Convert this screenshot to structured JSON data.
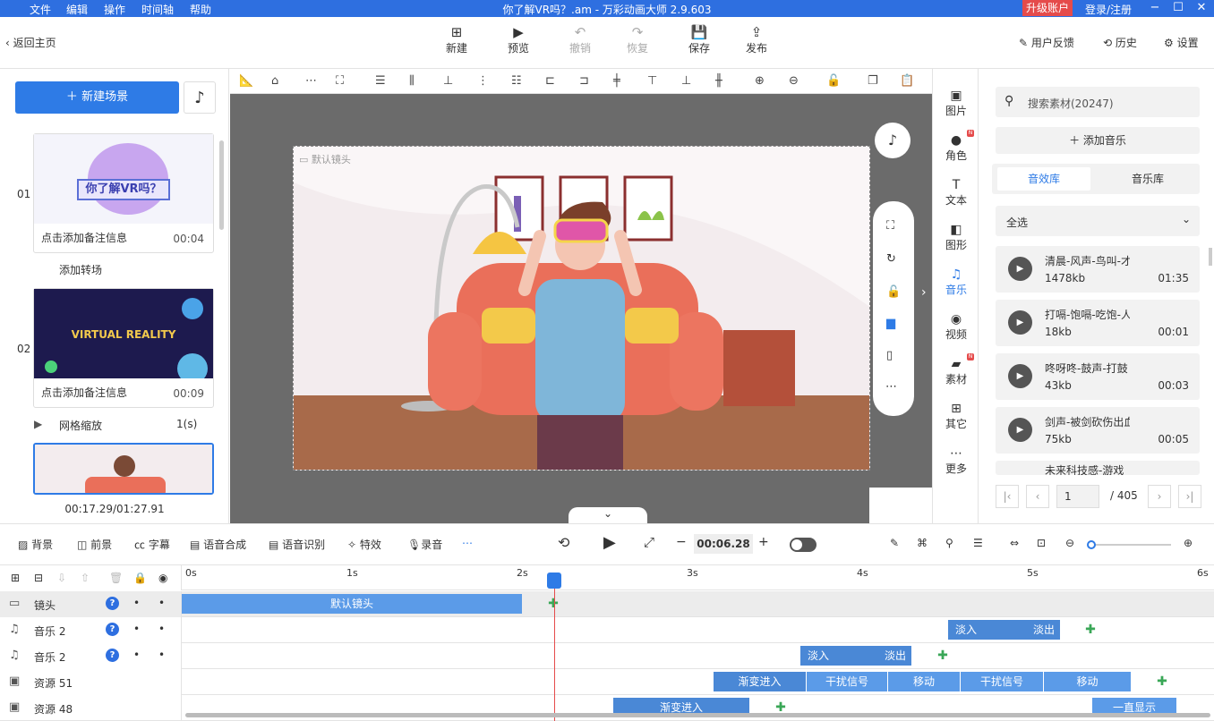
{
  "titlebar": {
    "menus": [
      "文件",
      "编辑",
      "操作",
      "时间轴",
      "帮助"
    ],
    "title": "你了解VR吗？.am - 万彩动画大师 2.9.603",
    "upgrade": "升级账户",
    "login": "登录/注册"
  },
  "toolbar": {
    "back": "返回主页",
    "new": "新建",
    "preview": "预览",
    "undo": "撤销",
    "redo": "恢复",
    "save": "保存",
    "publish": "发布",
    "feedback": "用户反馈",
    "history": "历史",
    "settings": "设置"
  },
  "left": {
    "new_scene": "新建场景",
    "scenes": [
      {
        "num": "01",
        "note": "点击添加备注信息",
        "time": "00:04",
        "thumb_text": "你了解VR吗？"
      },
      {
        "num": "02",
        "note": "点击添加备注信息",
        "time": "00:09",
        "thumb_text": "VIRTUAL REALITY"
      }
    ],
    "add_transition": "添加转场",
    "transition": "网格缩放",
    "transition_dur": "1(s)",
    "time_total": "00:17.29/01:27.91"
  },
  "stage": {
    "camera_label": "默认镜头"
  },
  "side": {
    "items": [
      "图片",
      "角色",
      "文本",
      "图形",
      "音乐",
      "视频",
      "素材",
      "其它",
      "更多"
    ]
  },
  "right": {
    "search": "搜索素材(20247)",
    "add_music": "添加音乐",
    "tabs": [
      "音效库",
      "音乐库"
    ],
    "filter": "全选",
    "items": [
      {
        "name": "清晨-风声-鸟叫-才",
        "size": "1478kb",
        "dur": "01:35"
      },
      {
        "name": "打嗝-饱嗝-吃饱-人",
        "size": "18kb",
        "dur": "00:01"
      },
      {
        "name": "咚呀咚-鼓声-打鼓",
        "size": "43kb",
        "dur": "00:03"
      },
      {
        "name": "剑声-被剑砍伤出血",
        "size": "75kb",
        "dur": "00:05"
      },
      {
        "name": "未来科技感-游戏",
        "size": "",
        "dur": ""
      }
    ],
    "page": "1",
    "pages": "/ 405"
  },
  "tl_toolbar": {
    "bg": "背景",
    "fg": "前景",
    "subtitle": "字幕",
    "tts": "语音合成",
    "asr": "语音识别",
    "effects": "特效",
    "record": "录音",
    "time": "00:06.28"
  },
  "timeline": {
    "ticks": [
      "0s",
      "1s",
      "2s",
      "3s",
      "4s",
      "5s",
      "6s"
    ],
    "tracks": [
      {
        "name": "镜头"
      },
      {
        "name": "音乐 2"
      },
      {
        "name": "音乐 2"
      },
      {
        "name": "资源 51"
      },
      {
        "name": "资源 48"
      }
    ],
    "clips": {
      "camera": "默认镜头",
      "fade_in": "淡入",
      "fade_out": "淡出",
      "fade_in_anim": "渐变进入",
      "glitch": "干扰信号",
      "move": "移动",
      "always": "一直显示"
    }
  }
}
